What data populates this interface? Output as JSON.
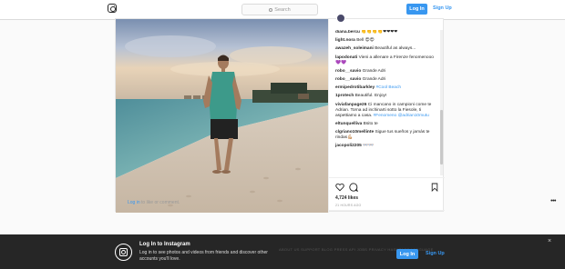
{
  "nav": {
    "search_placeholder": "Search",
    "login_label": "Log In",
    "signup_label": "Sign Up"
  },
  "post": {
    "comments": [
      {
        "user": "diana.bercu",
        "text": "👏👏👏👏❤❤❤❤"
      },
      {
        "user": "light.nora",
        "text": "Bell 😍😍"
      },
      {
        "user": "awazeh_soleimani",
        "text": "Beautiful as always..."
      },
      {
        "user": "lapodonati",
        "text": "Vieni a allenare a Firenze fenomenooo💜💜"
      },
      {
        "user": "robo__savio",
        "text": "Grande Adri"
      },
      {
        "user": "robo__savio",
        "text": "Grande Adri"
      },
      {
        "user": "ermipedrotibarkley",
        "text": "",
        "tag": "#Cool Beach"
      },
      {
        "user": "1protech",
        "text": "Beautiful. Enjoy!"
      },
      {
        "user": "viviafanpage26",
        "text": "Ci mancano in campioni come te Adrian. Torna ad inchinarti sotto la Fiesole, ti aspettiamo a casa.",
        "tag": "#Fenomeno",
        "mention": "@adrian10mutu"
      },
      {
        "user": "eltunquelliva",
        "text": "Bsito te"
      },
      {
        "user": "clgriano10mellinte",
        "text": "Sigue tus sueños y jamás te rindas💪🏼"
      },
      {
        "user": "jacopoli2205",
        "text": "👓👓"
      }
    ],
    "likes": "4,724 likes",
    "time": "21 HOURS AGO",
    "login_link": "Log in",
    "login_suffix": " to like or comment."
  },
  "banner": {
    "title": "Log In to Instagram",
    "text": "Log in to see photos and videos from friends and discover other accounts you'll love.",
    "footer_links": "ABOUT US   SUPPORT   BLOG   PRESS   API   JOBS   PRIVACY   HASHTAGS   LANGUAGE",
    "login_label": "Log In",
    "signup_label": "Sign Up",
    "close": "×"
  },
  "colors": {
    "accent": "#3897f0",
    "banner_bg": "#262626"
  }
}
